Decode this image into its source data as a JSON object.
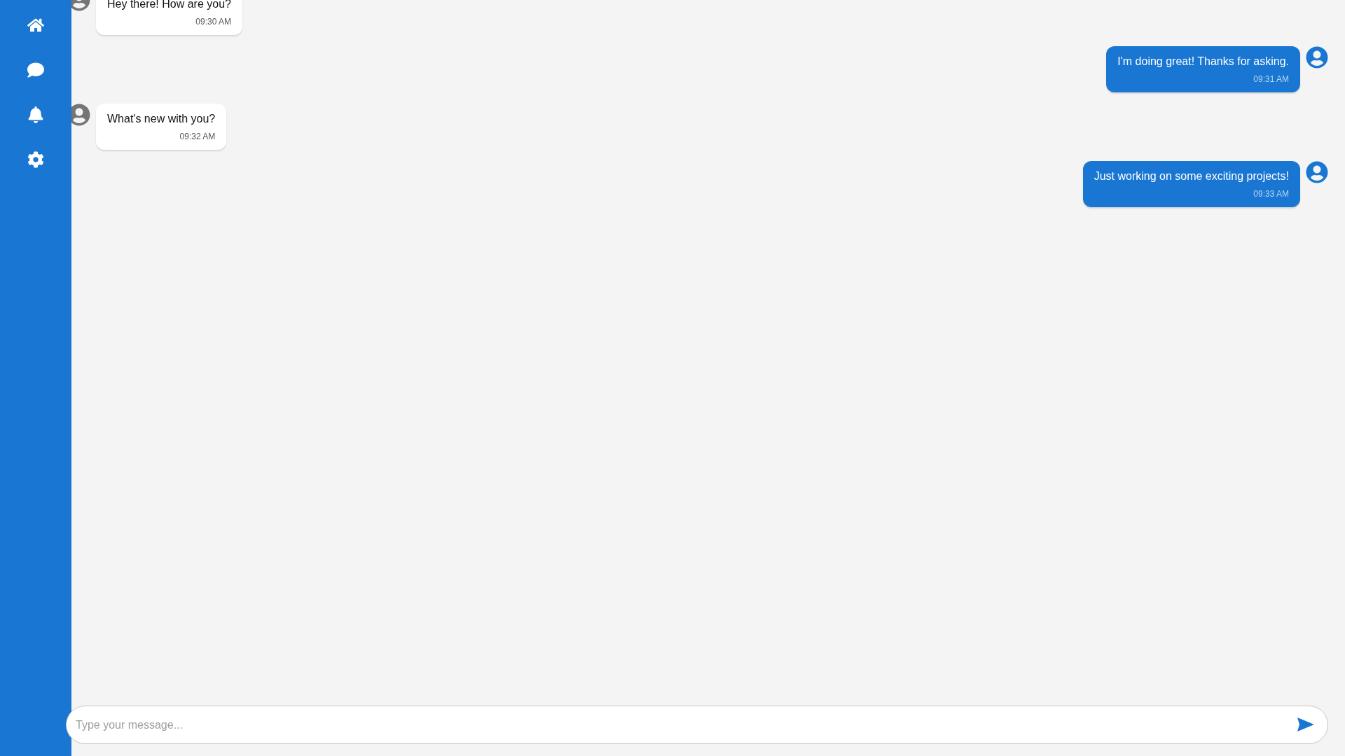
{
  "sidebar": {
    "items": [
      {
        "kind": "home"
      },
      {
        "kind": "chat"
      },
      {
        "kind": "bell"
      },
      {
        "kind": "gear"
      }
    ]
  },
  "messages": [
    {
      "kind": "received",
      "text": "Hey there! How are you?",
      "time": "09:30 AM"
    },
    {
      "kind": "sent",
      "text": "I'm doing great! Thanks for asking.",
      "time": "09:31 AM"
    },
    {
      "kind": "received",
      "text": "What's new with you?",
      "time": "09:32 AM"
    },
    {
      "kind": "sent",
      "text": "Just working on some exciting projects!",
      "time": "09:33 AM"
    }
  ],
  "composer": {
    "placeholder": "Type your message..."
  }
}
